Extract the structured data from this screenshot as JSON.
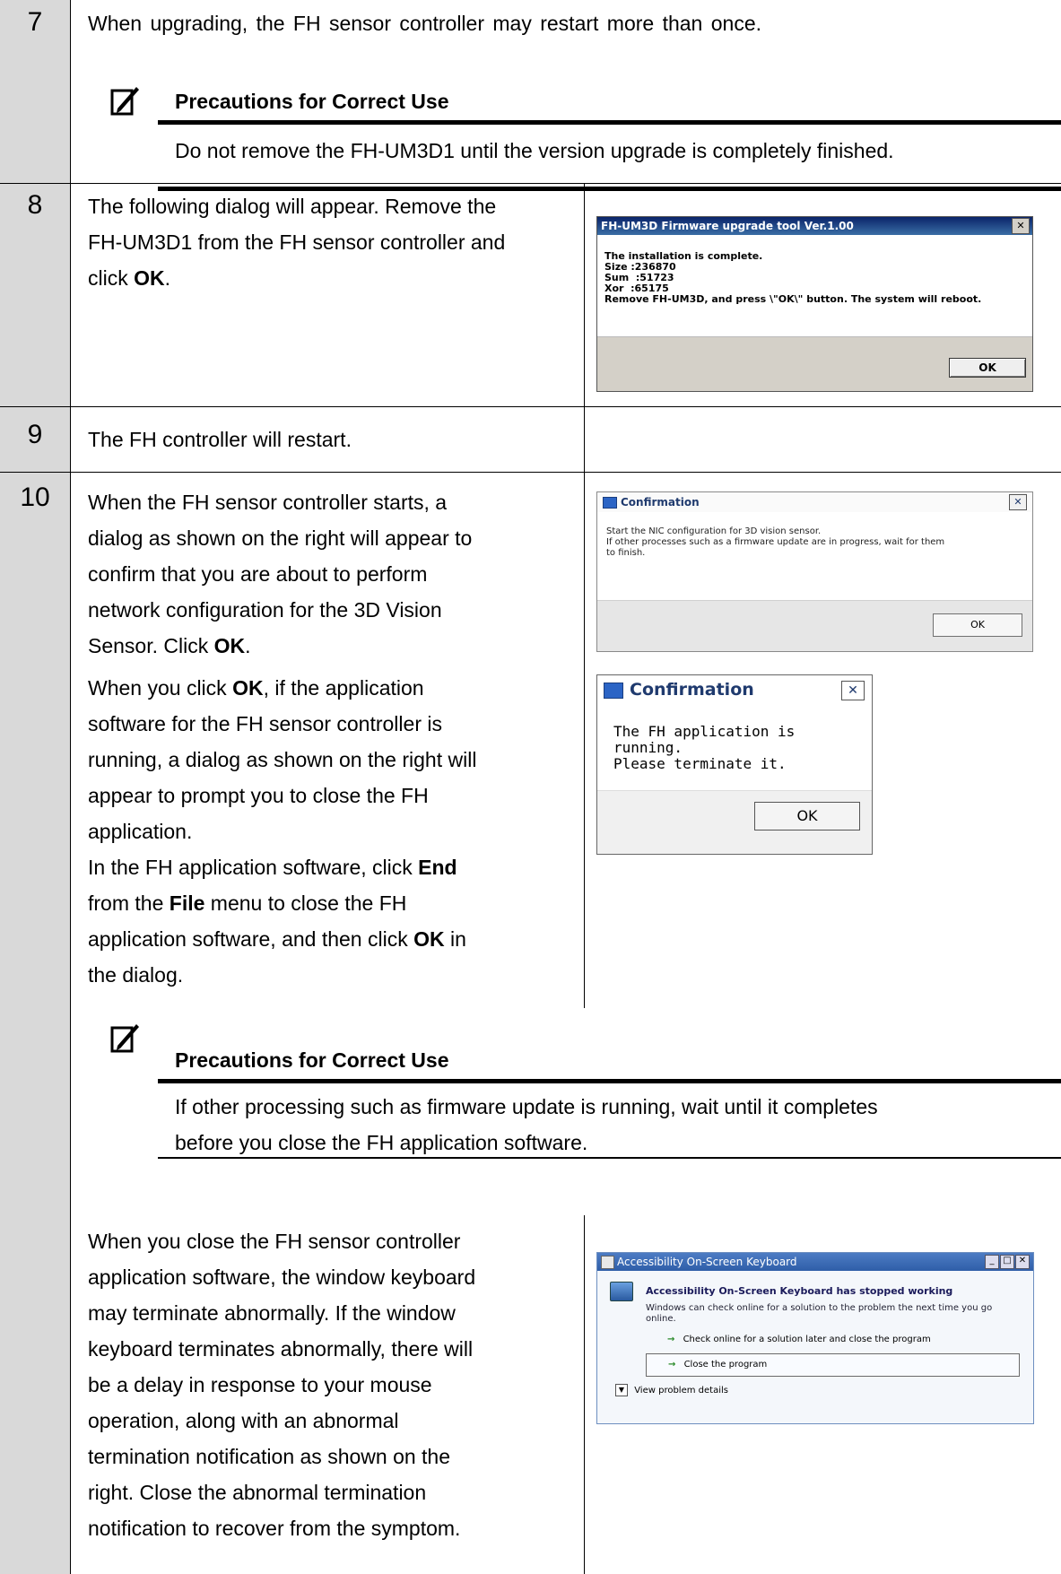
{
  "steps": {
    "s7": {
      "num": "7",
      "text": "When upgrading, the FH sensor controller may restart more than once.",
      "precaution_title": "Precautions for Correct Use",
      "precaution_text": "Do not remove the FH-UM3D1 until the version upgrade is completely finished."
    },
    "s8": {
      "num": "8",
      "line1": "The following dialog will appear. Remove the",
      "line2": "FH-UM3D1 from the FH sensor controller and",
      "line3_pre": "click ",
      "line3_bold": "OK",
      "line3_post": "."
    },
    "s9": {
      "num": "9",
      "text": "The FH controller will restart."
    },
    "s10": {
      "num": "10",
      "p1": [
        "When the FH sensor controller starts, a",
        "dialog as shown on the right will appear to",
        "confirm that you are about to perform",
        "network configuration for the 3D Vision"
      ],
      "p1_last_pre": "Sensor. Click ",
      "p1_last_bold": "OK",
      "p1_last_post": ".",
      "p2_l1_pre": "When you click ",
      "p2_l1_bold": "OK",
      "p2_l1_post": ", if the application",
      "p2_lines": [
        "software for the FH sensor controller is",
        "running, a dialog as shown on the right will",
        "appear to prompt you to close the FH",
        "application."
      ],
      "p3_l1_pre": "In the FH application software, click ",
      "p3_l1_bold": "End",
      "p3_l2_pre": "from the ",
      "p3_l2_bold": "File",
      "p3_l2_post": " menu to close the FH",
      "p3_l3_pre": "application software, and then click ",
      "p3_l3_bold": "OK",
      "p3_l3_post": " in",
      "p3_l4": "the dialog.",
      "precaution_title": "Precautions for Correct Use",
      "precaution_l1": "If other processing such as firmware update is running, wait until it completes",
      "precaution_l2": "before you close the FH application software.",
      "p4_lines": [
        "When you close the FH sensor controller",
        "application software, the window keyboard",
        "may terminate abnormally. If the window",
        "keyboard terminates abnormally, there will",
        "be a delay in response to your mouse",
        "operation, along with an abnormal",
        "termination notification as shown on the",
        "right. Close the abnormal termination",
        "notification to recover from the symptom."
      ]
    }
  },
  "dialogs": {
    "firmware": {
      "title": "FH-UM3D Firmware upgrade tool Ver.1.00",
      "lines": [
        "The installation is complete.",
        "Size :236870",
        "Sum  :51723",
        "Xor  :65175",
        "Remove FH-UM3D, and press \\\"OK\\\" button. The system will reboot."
      ],
      "ok": "OK"
    },
    "confirm_nic": {
      "title": "Confirmation",
      "lines": [
        "Start the NIC configuration for 3D vision sensor.",
        "If other processes such as a firmware update are in progress, wait for them",
        "to finish."
      ],
      "ok": "OK"
    },
    "confirm_running": {
      "title": "Confirmation",
      "lines": [
        "The FH application is running.",
        "Please terminate it."
      ],
      "ok": "OK"
    },
    "keyboard": {
      "title": "Accessibility On-Screen Keyboard",
      "heading": "Accessibility On-Screen Keyboard has stopped working",
      "desc": "Windows can check online for a solution to the problem the next time you go online.",
      "option1": "Check online for a solution later and close the program",
      "option2": "Close the program",
      "details": "View problem details"
    }
  },
  "colors": {
    "step_bg": "#d9d9d9",
    "xp_title": "#0a246a",
    "win_blue": "#1f4e9c"
  }
}
